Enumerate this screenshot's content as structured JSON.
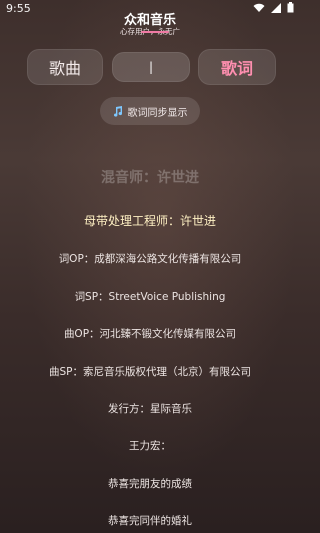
{
  "status_bar": {
    "time": "9:55"
  },
  "header": {
    "title": "众和音乐",
    "subtitle": "心存用户，永无广"
  },
  "tabs": {
    "songs_label": "歌曲",
    "center_label": "|",
    "lyrics_label": "歌词"
  },
  "sync_button": {
    "icon": "music-note-icon",
    "label": "歌词同步显示"
  },
  "colors": {
    "accent": "#ff8fb0",
    "current_line": "#fff1c4"
  },
  "lyrics": [
    "混音师：许世进",
    "母带处理工程师：许世进",
    "词OP：成都深海公路文化传播有限公司",
    "词SP：StreetVoice Publishing",
    "曲OP：河北臻不锻文化传媒有限公司",
    "曲SP：索尼音乐版权代理（北京）有限公司",
    "发行方：星际音乐",
    "王力宏：",
    "恭喜完朋友的成绩",
    "恭喜完同伴的婚礼"
  ]
}
